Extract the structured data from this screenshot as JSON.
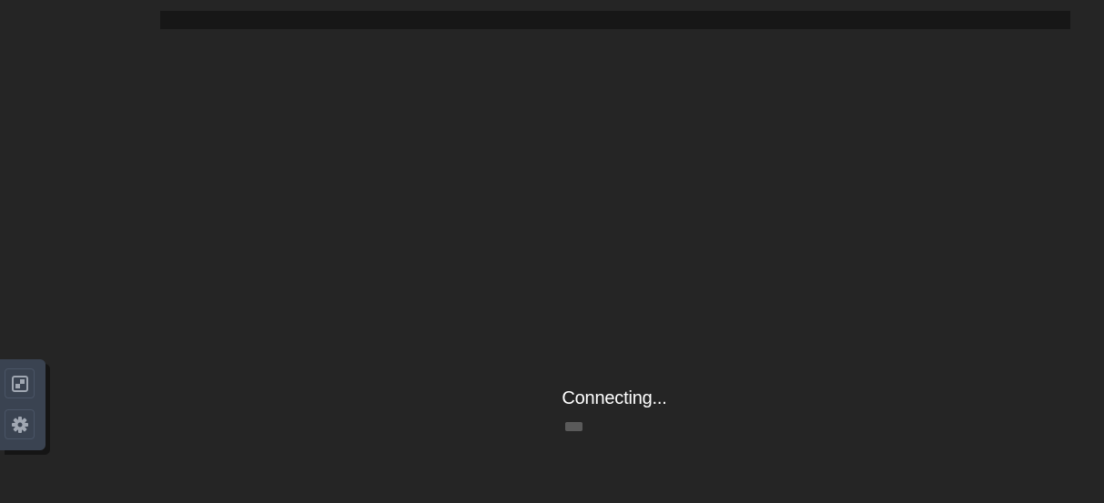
{
  "status": {
    "text": "Connecting..."
  },
  "icons": {
    "fullscreen": "fullscreen-icon",
    "settings": "gear-icon"
  },
  "colors": {
    "background": "#252525",
    "top_bar": "#171717",
    "panel": "#3a4351",
    "icon": "#a0a7b2",
    "status_text": "#ffffff"
  }
}
